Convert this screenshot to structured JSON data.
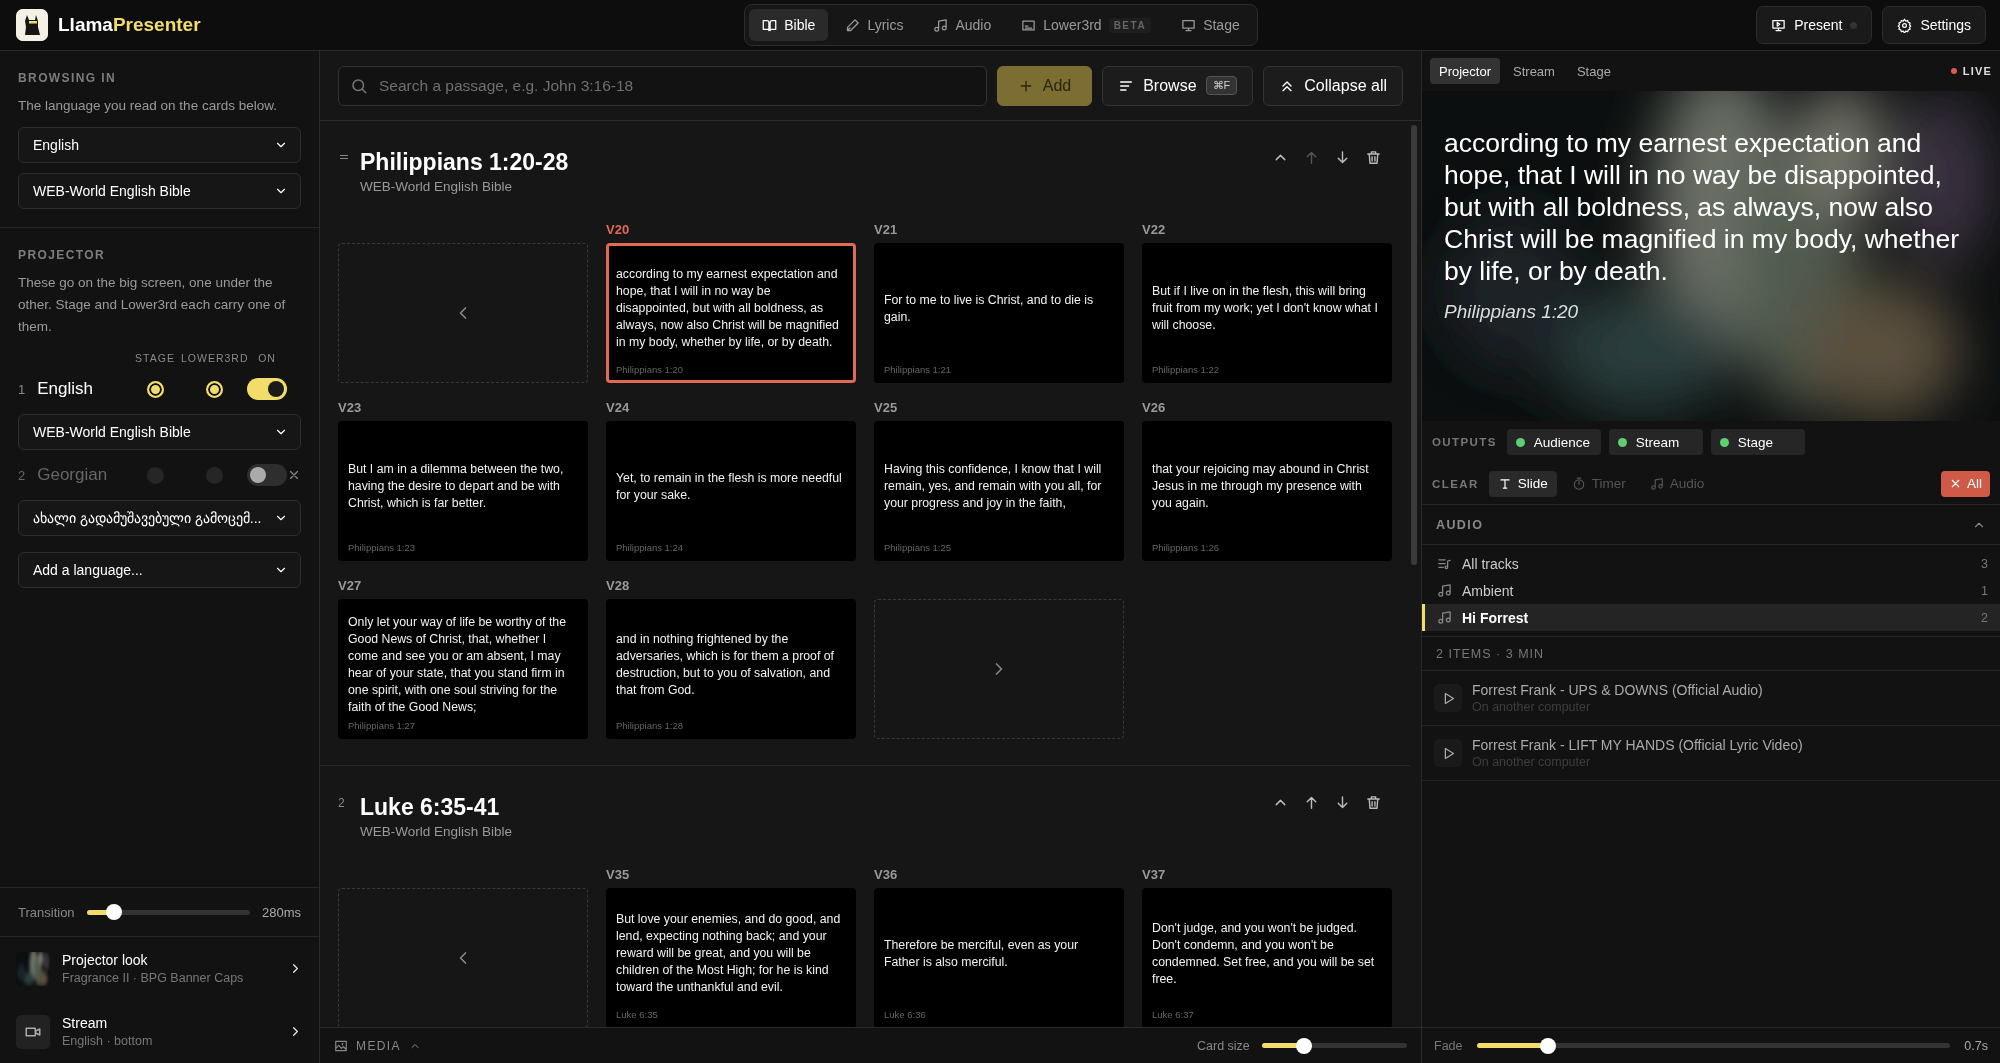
{
  "app": {
    "name": "Llama",
    "name_accent": "Presenter"
  },
  "mode_tabs": [
    {
      "label": "Bible",
      "selected": true
    },
    {
      "label": "Lyrics",
      "selected": false
    },
    {
      "label": "Audio",
      "selected": false
    },
    {
      "label": "Lower3rd",
      "badge": "BETA",
      "selected": false
    },
    {
      "label": "Stage",
      "selected": false
    }
  ],
  "header_buttons": [
    {
      "label": "Present"
    },
    {
      "label": "Settings"
    }
  ],
  "sidebar": {
    "browsing": {
      "heading": "BROWSING IN",
      "description": "The language you read on the cards below.",
      "selects": [
        "English",
        "WEB-World English Bible"
      ]
    },
    "projector": {
      "heading": "PROJECTOR",
      "description": "These go on the big screen, one under the other. Stage and Lower3rd each carry one of them.",
      "columns": [
        "STAGE",
        "LOWER3RD",
        "ON"
      ],
      "languages": [
        {
          "number": "1",
          "name": "English",
          "stage": true,
          "lower3rd": true,
          "on": true,
          "removable": false,
          "version": "WEB-World English Bible"
        },
        {
          "number": "2",
          "name": "Georgian",
          "stage": false,
          "lower3rd": false,
          "on": false,
          "removable": true,
          "version": "ახალი გადამუშავებული გამოცემ..."
        }
      ],
      "add_language": "Add a language..."
    },
    "transition": {
      "label": "Transition",
      "level": 0.17,
      "reading": "280ms"
    },
    "footer_items": [
      {
        "kind": "picture",
        "title": "Projector look",
        "subtitle": "Fragrance II · BPG Banner Caps"
      },
      {
        "kind": "camera",
        "title": "Stream",
        "subtitle": "English · bottom"
      }
    ]
  },
  "main": {
    "search": {
      "placeholder": "Search a passage, e.g. John 3:16-18"
    },
    "add_button": "Add",
    "browse_button": {
      "label": "Browse",
      "shortcut": "⌘F"
    },
    "collapse_button": "Collapse all",
    "passages": [
      {
        "handle": true,
        "title": "Philippians 1:20-28",
        "version": "WEB-World English Bible",
        "move_up_disabled": true,
        "cards": [
          {
            "kind": "prev"
          },
          {
            "kind": "verse",
            "label": "V20",
            "text": "according to my earnest expectation and hope, that I will in no way be disappointed, but with all boldness, as always, now also Christ will be magnified in my body, whether by life, or by death.",
            "ref": "Philippians 1:20",
            "selected": true
          },
          {
            "kind": "verse",
            "label": "V21",
            "text": "For to me to live is Christ, and to die is gain.",
            "ref": "Philippians 1:21",
            "selected": false
          },
          {
            "kind": "verse",
            "label": "V22",
            "text": "But if I live on in the flesh, this will bring fruit from my work; yet I don't know what I will choose.",
            "ref": "Philippians 1:22",
            "selected": false
          },
          {
            "kind": "verse",
            "label": "V23",
            "text": "But I am in a dilemma between the two, having the desire to depart and be with Christ, which is far better.",
            "ref": "Philippians 1:23",
            "selected": false
          },
          {
            "kind": "verse",
            "label": "V24",
            "text": "Yet, to remain in the flesh is more needful for your sake.",
            "ref": "Philippians 1:24",
            "selected": false
          },
          {
            "kind": "verse",
            "label": "V25",
            "text": "Having this confidence, I know that I will remain, yes, and remain with you all, for your progress and joy in the faith,",
            "ref": "Philippians 1:25",
            "selected": false
          },
          {
            "kind": "verse",
            "label": "V26",
            "text": "that your rejoicing may abound in Christ Jesus in me through my presence with you again.",
            "ref": "Philippians 1:26",
            "selected": false
          },
          {
            "kind": "verse",
            "label": "V27",
            "text": "Only let your way of life be worthy of the Good News of Christ, that, whether I come and see you or am absent, I may hear of your state, that you stand firm in one spirit, with one soul striving for the faith of the Good News;",
            "ref": "Philippians 1:27",
            "selected": false
          },
          {
            "kind": "verse",
            "label": "V28",
            "text": "and in nothing frightened by the adversaries, which is for them a proof of destruction, but to you of salvation, and that from God.",
            "ref": "Philippians 1:28",
            "selected": false
          },
          {
            "kind": "next"
          }
        ]
      },
      {
        "handle": false,
        "number": "2",
        "title": "Luke 6:35-41",
        "version": "WEB-World English Bible",
        "move_up_disabled": false,
        "cards": [
          {
            "kind": "prev"
          },
          {
            "kind": "verse",
            "label": "V35",
            "text": "But love your enemies, and do good, and lend, expecting nothing back; and your reward will be great, and you will be children of the Most High; for he is kind toward the unthankful and evil.",
            "ref": "Luke 6:35",
            "selected": false
          },
          {
            "kind": "verse",
            "label": "V36",
            "text": "Therefore be merciful, even as your Father is also merciful.",
            "ref": "Luke 6:36",
            "selected": false
          },
          {
            "kind": "verse",
            "label": "V37",
            "text": "Don't judge, and you won't be judged. Don't condemn, and you won't be condemned. Set free, and you will be set free.",
            "ref": "Luke 6:37",
            "selected": false
          }
        ]
      }
    ],
    "media_label": "MEDIA",
    "card_size": {
      "label": "Card size",
      "level": 0.29
    }
  },
  "right": {
    "preview_tabs": [
      {
        "label": "Projector",
        "selected": true
      },
      {
        "label": "Stream",
        "selected": false
      },
      {
        "label": "Stage",
        "selected": false
      }
    ],
    "live": "LIVE",
    "preview": {
      "text": "according to my earnest expectation and hope, that I will in no way be disappointed, but with all boldness, as always, now also Christ will be magnified in my body, whether by life, or by death.",
      "ref": "Philippians 1:20"
    },
    "outputs": {
      "label": "OUTPUTS",
      "items": [
        {
          "label": "Audience",
          "on": true
        },
        {
          "label": "Stream",
          "on": true
        },
        {
          "label": "Stage",
          "on": true
        }
      ]
    },
    "clear": {
      "label": "CLEAR",
      "items": [
        {
          "label": "Slide",
          "disabled": false
        },
        {
          "label": "Timer",
          "disabled": true
        },
        {
          "label": "Audio",
          "disabled": true
        }
      ],
      "all_button": "All"
    },
    "audio": {
      "heading": "AUDIO",
      "expanded": true,
      "playlists": [
        {
          "kind": "all",
          "name": "All tracks",
          "count": "3",
          "selected": false
        },
        {
          "kind": "list",
          "name": "Ambient",
          "count": "1",
          "selected": false
        },
        {
          "kind": "list",
          "name": "Hi Forrest",
          "count": "2",
          "selected": true
        }
      ],
      "summary": "2 ITEMS · 3 MIN",
      "tracks": [
        {
          "title": "Forrest Frank - UPS & DOWNS (Official Audio)",
          "subtitle": "On another computer"
        },
        {
          "title": "Forrest Frank - LIFT MY HANDS (Official Lyric Video)",
          "subtitle": "On another computer"
        }
      ]
    },
    "fade": {
      "label": "Fade",
      "level": 0.15,
      "reading": "0.7s"
    }
  }
}
